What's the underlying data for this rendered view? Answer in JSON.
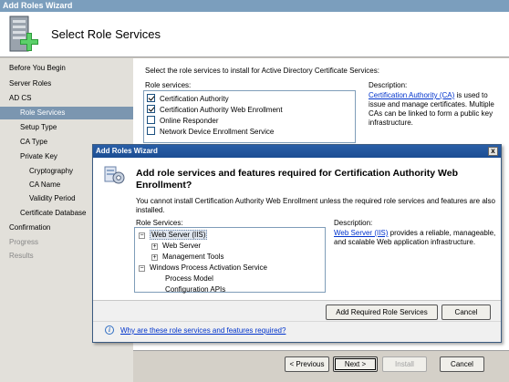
{
  "window": {
    "title": "Add Roles Wizard",
    "page_title": "Select Role Services"
  },
  "nav": {
    "items": [
      {
        "label": "Before You Begin",
        "state": "normal"
      },
      {
        "label": "Server Roles",
        "state": "normal"
      },
      {
        "label": "AD CS",
        "state": "normal"
      },
      {
        "label": "Role Services",
        "state": "selected"
      },
      {
        "label": "Setup Type",
        "state": "normal"
      },
      {
        "label": "CA Type",
        "state": "normal"
      },
      {
        "label": "Private Key",
        "state": "normal"
      },
      {
        "label": "Cryptography",
        "state": "normal"
      },
      {
        "label": "CA Name",
        "state": "normal"
      },
      {
        "label": "Validity Period",
        "state": "normal"
      },
      {
        "label": "Certificate Database",
        "state": "normal"
      },
      {
        "label": "Confirmation",
        "state": "normal"
      },
      {
        "label": "Progress",
        "state": "disabled"
      },
      {
        "label": "Results",
        "state": "disabled"
      }
    ]
  },
  "main": {
    "instruction": "Select the role services to install for Active Directory Certificate Services:",
    "role_services_label": "Role services:",
    "role_services": [
      {
        "label": "Certification Authority",
        "checked": true
      },
      {
        "label": "Certification Authority Web Enrollment",
        "checked": true
      },
      {
        "label": "Online Responder",
        "checked": false
      },
      {
        "label": "Network Device Enrollment Service",
        "checked": false
      }
    ],
    "description_label": "Description:",
    "description_link": "Certification Authority (CA)",
    "description_text": " is used to issue and manage certificates. Multiple CAs can be linked to form a public key infrastructure."
  },
  "footer": {
    "previous": "< Previous",
    "next": "Next >",
    "install": "Install",
    "cancel": "Cancel"
  },
  "dialog": {
    "title": "Add Roles Wizard",
    "close": "x",
    "heading": "Add role services and features required for Certification Authority Web Enrollment?",
    "info": "You cannot install Certification Authority Web Enrollment unless the required role services and features are also installed.",
    "role_services_label": "Role Services:",
    "description_label": "Description:",
    "tree": [
      {
        "label": "Web Server (IIS)",
        "expander": "minus"
      },
      {
        "label": "Web Server",
        "expander": "plus"
      },
      {
        "label": "Management Tools",
        "expander": "plus"
      },
      {
        "label": "Windows Process Activation Service",
        "expander": "minus"
      },
      {
        "label": "Process Model",
        "expander": ""
      },
      {
        "label": "Configuration APIs",
        "expander": ""
      }
    ],
    "description_link": "Web Server (IIS)",
    "description_text": " provides a reliable, manageable, and scalable Web application infrastructure.",
    "add_button": "Add Required Role Services",
    "cancel_button": "Cancel",
    "help_link": "Why are these role services and features required?"
  }
}
